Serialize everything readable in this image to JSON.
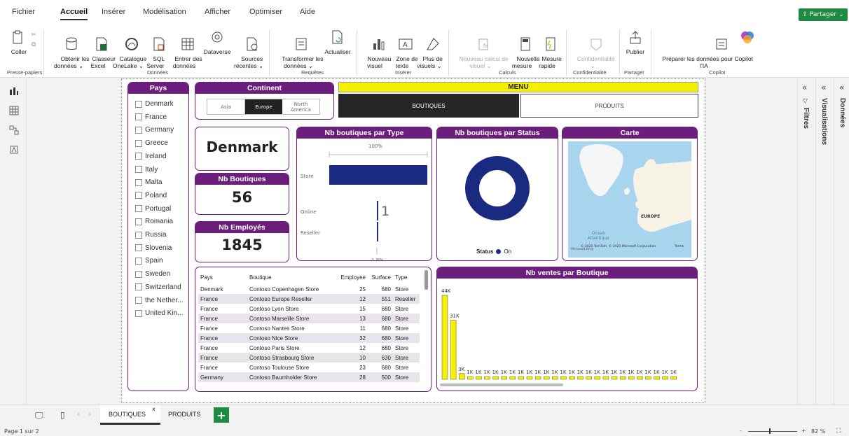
{
  "menu": {
    "items": [
      "Fichier",
      "Accueil",
      "Insérer",
      "Modélisation",
      "Afficher",
      "Optimiser",
      "Aide"
    ],
    "share": "Partager"
  },
  "ribbon": {
    "buttons": {
      "coller": "Coller",
      "obtenir": "Obtenir les\ndonnées ⌄",
      "classeur": "Classeur\nExcel",
      "catalogue": "Catalogue\nOneLake ⌄",
      "sql": "SQL\nServer",
      "entrer": "Entrer des\ndonnées",
      "dataverse": "Dataverse",
      "sources": "Sources\nrécentes ⌄",
      "transformer": "Transformer les\ndonnées ⌄",
      "actualiser": "Actualiser",
      "nouveau_visuel": "Nouveau\nvisuel",
      "zone_texte": "Zone de\ntexte",
      "plus_visuels": "Plus de\nvisuels ⌄",
      "nouveau_calcul": "Nouveau calcul de\nvisuel ⌄",
      "nouvelle_mesure": "Nouvelle\nmesure",
      "mesure_rapide": "Mesure\nrapide",
      "confidentialite": "Confidentialité\n⌄",
      "publier": "Publier",
      "preparer": "Préparer les données pour Copilot\nl'IA"
    },
    "groups": {
      "presse": "Presse-papiers",
      "donnees": "Données",
      "requetes": "Requêtes",
      "inserer": "Insérer",
      "calculs": "Calculs",
      "confidentialite": "Confidentialité",
      "partager": "Partager",
      "copilot": "Copilot"
    }
  },
  "panes": {
    "filtres": "Filtres",
    "visualisations": "Visualisations",
    "donnees": "Données"
  },
  "slicer_pays": {
    "title": "Pays",
    "items": [
      "Denmark",
      "France",
      "Germany",
      "Greece",
      "Ireland",
      "Italy",
      "Malta",
      "Poland",
      "Portugal",
      "Romania",
      "Russia",
      "Slovenia",
      "Spain",
      "Sweden",
      "Switzerland",
      "the Nether...",
      "United Kin..."
    ]
  },
  "slicer_continent": {
    "title": "Continent",
    "options": [
      "Asia",
      "Europe",
      "North\nAmerica"
    ],
    "selected": "Europe"
  },
  "menu_visual": {
    "title": "MENU",
    "buttons": [
      "BOUTIQUES",
      "PRODUITS"
    ],
    "selected": "BOUTIQUES"
  },
  "card_country": {
    "value": "Denmark"
  },
  "card_boutiques": {
    "title": "Nb Boutiques",
    "value": "56"
  },
  "card_employes": {
    "title": "Nb Employés",
    "value": "1845"
  },
  "chart_type": {
    "title": "Nb boutiques par Type",
    "top_label": "100%",
    "bottom_label": "1.9%",
    "data_label": "1"
  },
  "chart_status": {
    "title": "Nb boutiques par Status",
    "legend_title": "Status",
    "legend_item": "On"
  },
  "map": {
    "title": "Carte",
    "label_europe": "EUROPE",
    "label_ocean": "Ocean\nAtlantique",
    "credit": "© 2025 TomTom, © 2025 Microsoft Corporation",
    "terms": "Terms",
    "brand": "Microsoft Bing"
  },
  "table": {
    "headers": [
      "Pays",
      "Boutique",
      "Employee",
      "Surface",
      "Type"
    ],
    "rows": [
      [
        "Denmark",
        "Contoso Copenhagen Store",
        "25",
        "680",
        "Store"
      ],
      [
        "France",
        "Contoso Europe Reseller",
        "12",
        "551",
        "Reseller"
      ],
      [
        "France",
        "Contoso Lyon Store",
        "15",
        "680",
        "Store"
      ],
      [
        "France",
        "Contoso Marseille Store",
        "13",
        "680",
        "Store"
      ],
      [
        "France",
        "Contoso Nantes Store",
        "11",
        "680",
        "Store"
      ],
      [
        "France",
        "Contoso Nice Store",
        "32",
        "680",
        "Store"
      ],
      [
        "France",
        "Contoso Paris Store",
        "12",
        "680",
        "Store"
      ],
      [
        "France",
        "Contoso Strasbourg Store",
        "10",
        "630",
        "Store"
      ],
      [
        "France",
        "Contoso Toulouse Store",
        "23",
        "680",
        "Store"
      ],
      [
        "Germany",
        "Contoso Baumholder Store",
        "28",
        "500",
        "Store"
      ]
    ]
  },
  "chart_ventes": {
    "title": "Nb ventes par Boutique",
    "labels": [
      "44K",
      "31K",
      "3K",
      "1K"
    ]
  },
  "chart_data": [
    {
      "type": "bar",
      "title": "Nb boutiques par Type",
      "categories": [
        "Store",
        "Online",
        "Reseller"
      ],
      "values": [
        54,
        1,
        1
      ],
      "orientation": "horizontal",
      "color": "#1a2a80"
    },
    {
      "type": "pie",
      "title": "Nb boutiques par Status",
      "categories": [
        "On"
      ],
      "values": [
        56
      ],
      "donut": true,
      "color": "#1a2a80",
      "legend": "bottom"
    },
    {
      "type": "bar",
      "title": "Nb ventes par Boutique",
      "values": [
        44000,
        31000,
        3000,
        1000,
        1000,
        1000,
        1000,
        1000,
        1000,
        1000,
        1000,
        1000,
        1000,
        1000,
        1000,
        1000,
        1000,
        1000,
        1000,
        1000,
        1000,
        1000,
        1000,
        1000,
        1000,
        1000,
        1000,
        1000
      ],
      "color": "#f5f000"
    }
  ],
  "pages": {
    "tabs": [
      "BOUTIQUES",
      "PRODUITS"
    ],
    "active": "BOUTIQUES"
  },
  "status": {
    "page": "Page 1 sur 2",
    "zoom": "82 %"
  },
  "colors": {
    "accent": "#6b1e7b",
    "menu": "#f5f000",
    "bar": "#1a2a80",
    "green": "#1e8a44"
  }
}
